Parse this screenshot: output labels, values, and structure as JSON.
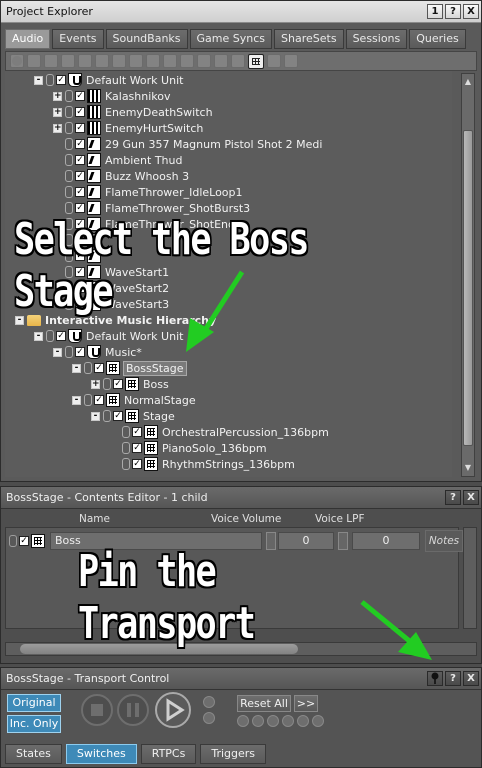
{
  "project_explorer": {
    "title": "Project Explorer",
    "window_buttons": [
      "1",
      "?",
      "X"
    ],
    "tabs": [
      "Audio",
      "Events",
      "SoundBanks",
      "Game Syncs",
      "ShareSets",
      "Sessions",
      "Queries"
    ],
    "active_tab": "Audio",
    "tree": [
      {
        "label": "Default Work Unit",
        "icon": "work-unit",
        "expander": "-",
        "indent": 1
      },
      {
        "label": "Kalashnikov",
        "icon": "switch-container",
        "expander": "+",
        "indent": 2
      },
      {
        "label": "EnemyDeathSwitch",
        "icon": "switch-container",
        "expander": "+",
        "indent": 2
      },
      {
        "label": "EnemyHurtSwitch",
        "icon": "switch-container",
        "expander": "+",
        "indent": 2
      },
      {
        "label": "29 Gun 357 Magnum Pistol Shot 2 Medi",
        "icon": "sound",
        "indent": 2
      },
      {
        "label": "Ambient Thud",
        "icon": "sound",
        "indent": 2
      },
      {
        "label": "Buzz Whoosh 3",
        "icon": "sound",
        "indent": 2
      },
      {
        "label": "FlameThrower_IdleLoop1",
        "icon": "sound",
        "indent": 2
      },
      {
        "label": "FlameThrower_ShotBurst3",
        "icon": "sound",
        "indent": 2
      },
      {
        "label": "FlameThrower_ShotEnd3",
        "icon": "sound",
        "indent": 2
      },
      {
        "label": "",
        "icon": "sound",
        "indent": 2
      },
      {
        "label": "",
        "icon": "sound",
        "indent": 2
      },
      {
        "label": "WaveStart1",
        "icon": "sound",
        "indent": 2
      },
      {
        "label": "WaveStart2",
        "icon": "sound",
        "indent": 2
      },
      {
        "label": "WaveStart3",
        "icon": "sound",
        "indent": 2
      },
      {
        "label": "Interactive Music Hierarchy",
        "icon": "folder",
        "expander": "-",
        "indent": 0,
        "bold": true
      },
      {
        "label": "Default Work Unit",
        "icon": "work-unit",
        "expander": "-",
        "indent": 1
      },
      {
        "label": "Music*",
        "icon": "work-unit",
        "expander": "-",
        "indent": 2
      },
      {
        "label": "BossStage",
        "icon": "music-switch",
        "expander": "-",
        "indent": 3,
        "selected": true
      },
      {
        "label": "Boss",
        "icon": "music-switch",
        "expander": "+",
        "indent": 4
      },
      {
        "label": "NormalStage",
        "icon": "music-switch",
        "expander": "-",
        "indent": 3
      },
      {
        "label": "Stage",
        "icon": "music-switch",
        "expander": "-",
        "indent": 4
      },
      {
        "label": "OrchestralPercussion_136bpm",
        "icon": "music-segment",
        "indent": 5
      },
      {
        "label": "PianoSolo_136bpm",
        "icon": "music-segment",
        "indent": 5
      },
      {
        "label": "RhythmStrings_136bpm",
        "icon": "music-segment",
        "indent": 5
      }
    ]
  },
  "contents_editor": {
    "title": "BossStage - Contents Editor - 1 child",
    "window_buttons": [
      "?",
      "X"
    ],
    "columns": [
      "Name",
      "Voice Volume",
      "Voice LPF"
    ],
    "row": {
      "name": "Boss",
      "voice_volume": "0",
      "voice_lpf": "0",
      "notes": "Notes"
    }
  },
  "transport": {
    "title": "BossStage - Transport Control",
    "window_buttons": [
      "?",
      "X"
    ],
    "original_label": "Original",
    "inc_only_label": "Inc. Only",
    "reset_all_label": "Reset All",
    "more_label": ">>",
    "bottom_tabs": [
      "States",
      "Switches",
      "RTPCs",
      "Triggers"
    ],
    "active_bottom_tab": "Switches"
  },
  "annotations": {
    "select_text": "Select the Boss Stage",
    "pin_text": "Pin the Transport",
    "arrow_color": "#22cc22"
  }
}
